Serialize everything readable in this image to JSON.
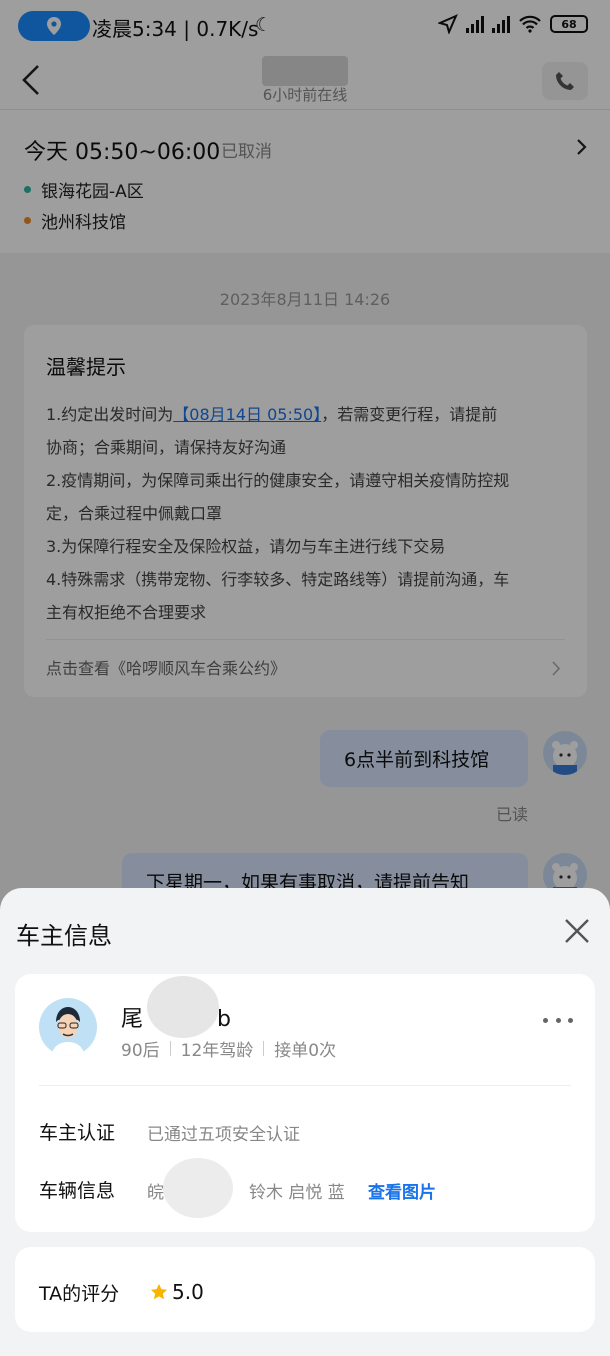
{
  "status_bar": {
    "time_speed": "凌晨5:34 | 0.7K/s",
    "battery": "68"
  },
  "nav": {
    "subtitle": "6小时前在线"
  },
  "trip": {
    "time": "今天 05:50~06:00",
    "status": "已取消",
    "start": "银海花园-A区",
    "end": "池州科技馆",
    "start_color": "#2bb5a0",
    "end_color": "#f08a24"
  },
  "chat": {
    "date": "2023年8月11日 14:26",
    "tips": {
      "title": "温馨提示",
      "line1_prefix": "1.约定出发时间为",
      "line1_link": "【08月14日 05:50】",
      "line1_suffix": "，若需变更行程，请提前",
      "line1b": "协商；合乘期间，请保持友好沟通",
      "line2a": "2.疫情期间，为保障司乘出行的健康安全，请遵守相关疫情防控规",
      "line2b": "定，合乘过程中佩戴口罩",
      "line3": "3.为保障行程安全及保险权益，请勿与车主进行线下交易",
      "line4a": "4.特殊需求（携带宠物、行李较多、特定路线等）请提前沟通，车",
      "line4b": "主有权拒绝不合理要求",
      "footer": "点击查看《哈啰顺风车合乘公约》"
    },
    "msg1": "6点半前到科技馆",
    "msg1_status": "已读",
    "msg2": "下星期一，如果有事取消，请提前告知"
  },
  "sheet": {
    "title": "车主信息",
    "driver": {
      "name_visible": "尾",
      "name_tail": "b",
      "age": "90后",
      "experience": "12年驾龄",
      "orders": "接单0次"
    },
    "cert_label": "车主认证",
    "cert_value": "已通过五项安全认证",
    "vehicle_label": "车辆信息",
    "vehicle_plate_prefix": "皖",
    "vehicle_desc": "铃木 启悦 蓝",
    "view_pics": "查看图片",
    "score_label": "TA的评分",
    "score_value": "5.0",
    "accent": "#1a73e8",
    "star_color": "#f7b500"
  },
  "icons": [
    "location-icon",
    "back-arrow-icon",
    "phone-icon",
    "chevron-right-icon",
    "close-icon",
    "more-icon",
    "star-icon",
    "avatar"
  ]
}
